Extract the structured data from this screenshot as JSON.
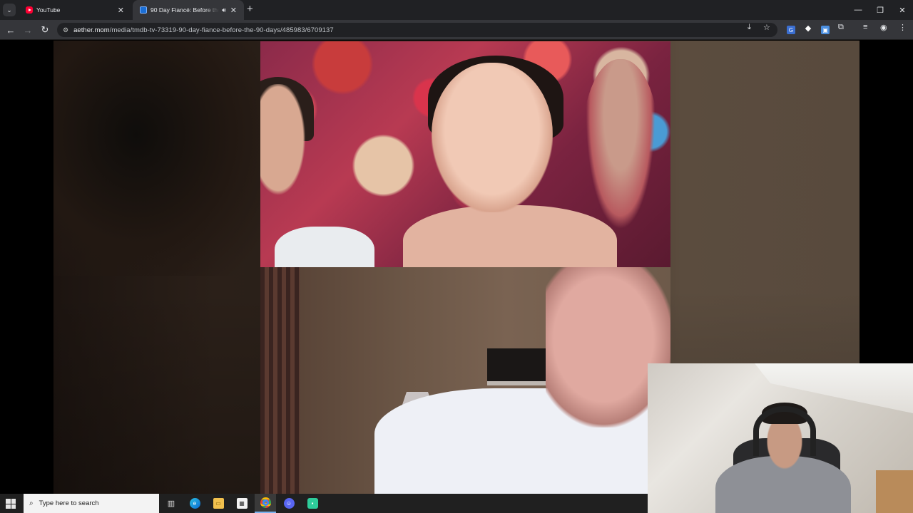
{
  "browser": {
    "tab_search_icon": "chevron-down-icon",
    "tabs": [
      {
        "title": "YouTube",
        "favicon": "youtube-icon",
        "active": false
      },
      {
        "title": "90 Day Fiancé: Before the 90",
        "favicon": "site-icon",
        "active": true,
        "audio": true
      }
    ],
    "window_controls": {
      "minimize": "—",
      "restore": "❐",
      "close": "✕"
    }
  },
  "toolbar": {
    "back": "←",
    "forward": "→",
    "reload": "↻",
    "url_host": "aether.mom",
    "url_path": "/media/tmdb-tv-73319-90-day-fiance-before-the-90-days/485983/6709137",
    "icons": [
      "install-app-icon",
      "bookmark-star-icon",
      "extension-translate-icon",
      "extension-diamond-icon",
      "extension-image-icon",
      "extensions-puzzle-icon",
      "media-control-icon",
      "profile-icon",
      "menu-kebab-icon"
    ]
  },
  "video": {
    "layout": "split-call",
    "top_panel": "woman-laughing-floral-backdrop",
    "bottom_panel": "man-smiling-hotel-room"
  },
  "webcam": {
    "subject": "viewer-with-headset"
  },
  "taskbar": {
    "search_placeholder": "Type here to search",
    "apps": [
      "task-view-icon",
      "edge-icon",
      "file-explorer-icon",
      "microsoft-store-icon",
      "chrome-icon",
      "discord-icon",
      "app-icon"
    ]
  },
  "colors": {
    "tabstrip_bg": "#202124",
    "toolbar_bg": "#35363a",
    "omnibox_bg": "#202124",
    "taskbar_bg": "#202020"
  }
}
